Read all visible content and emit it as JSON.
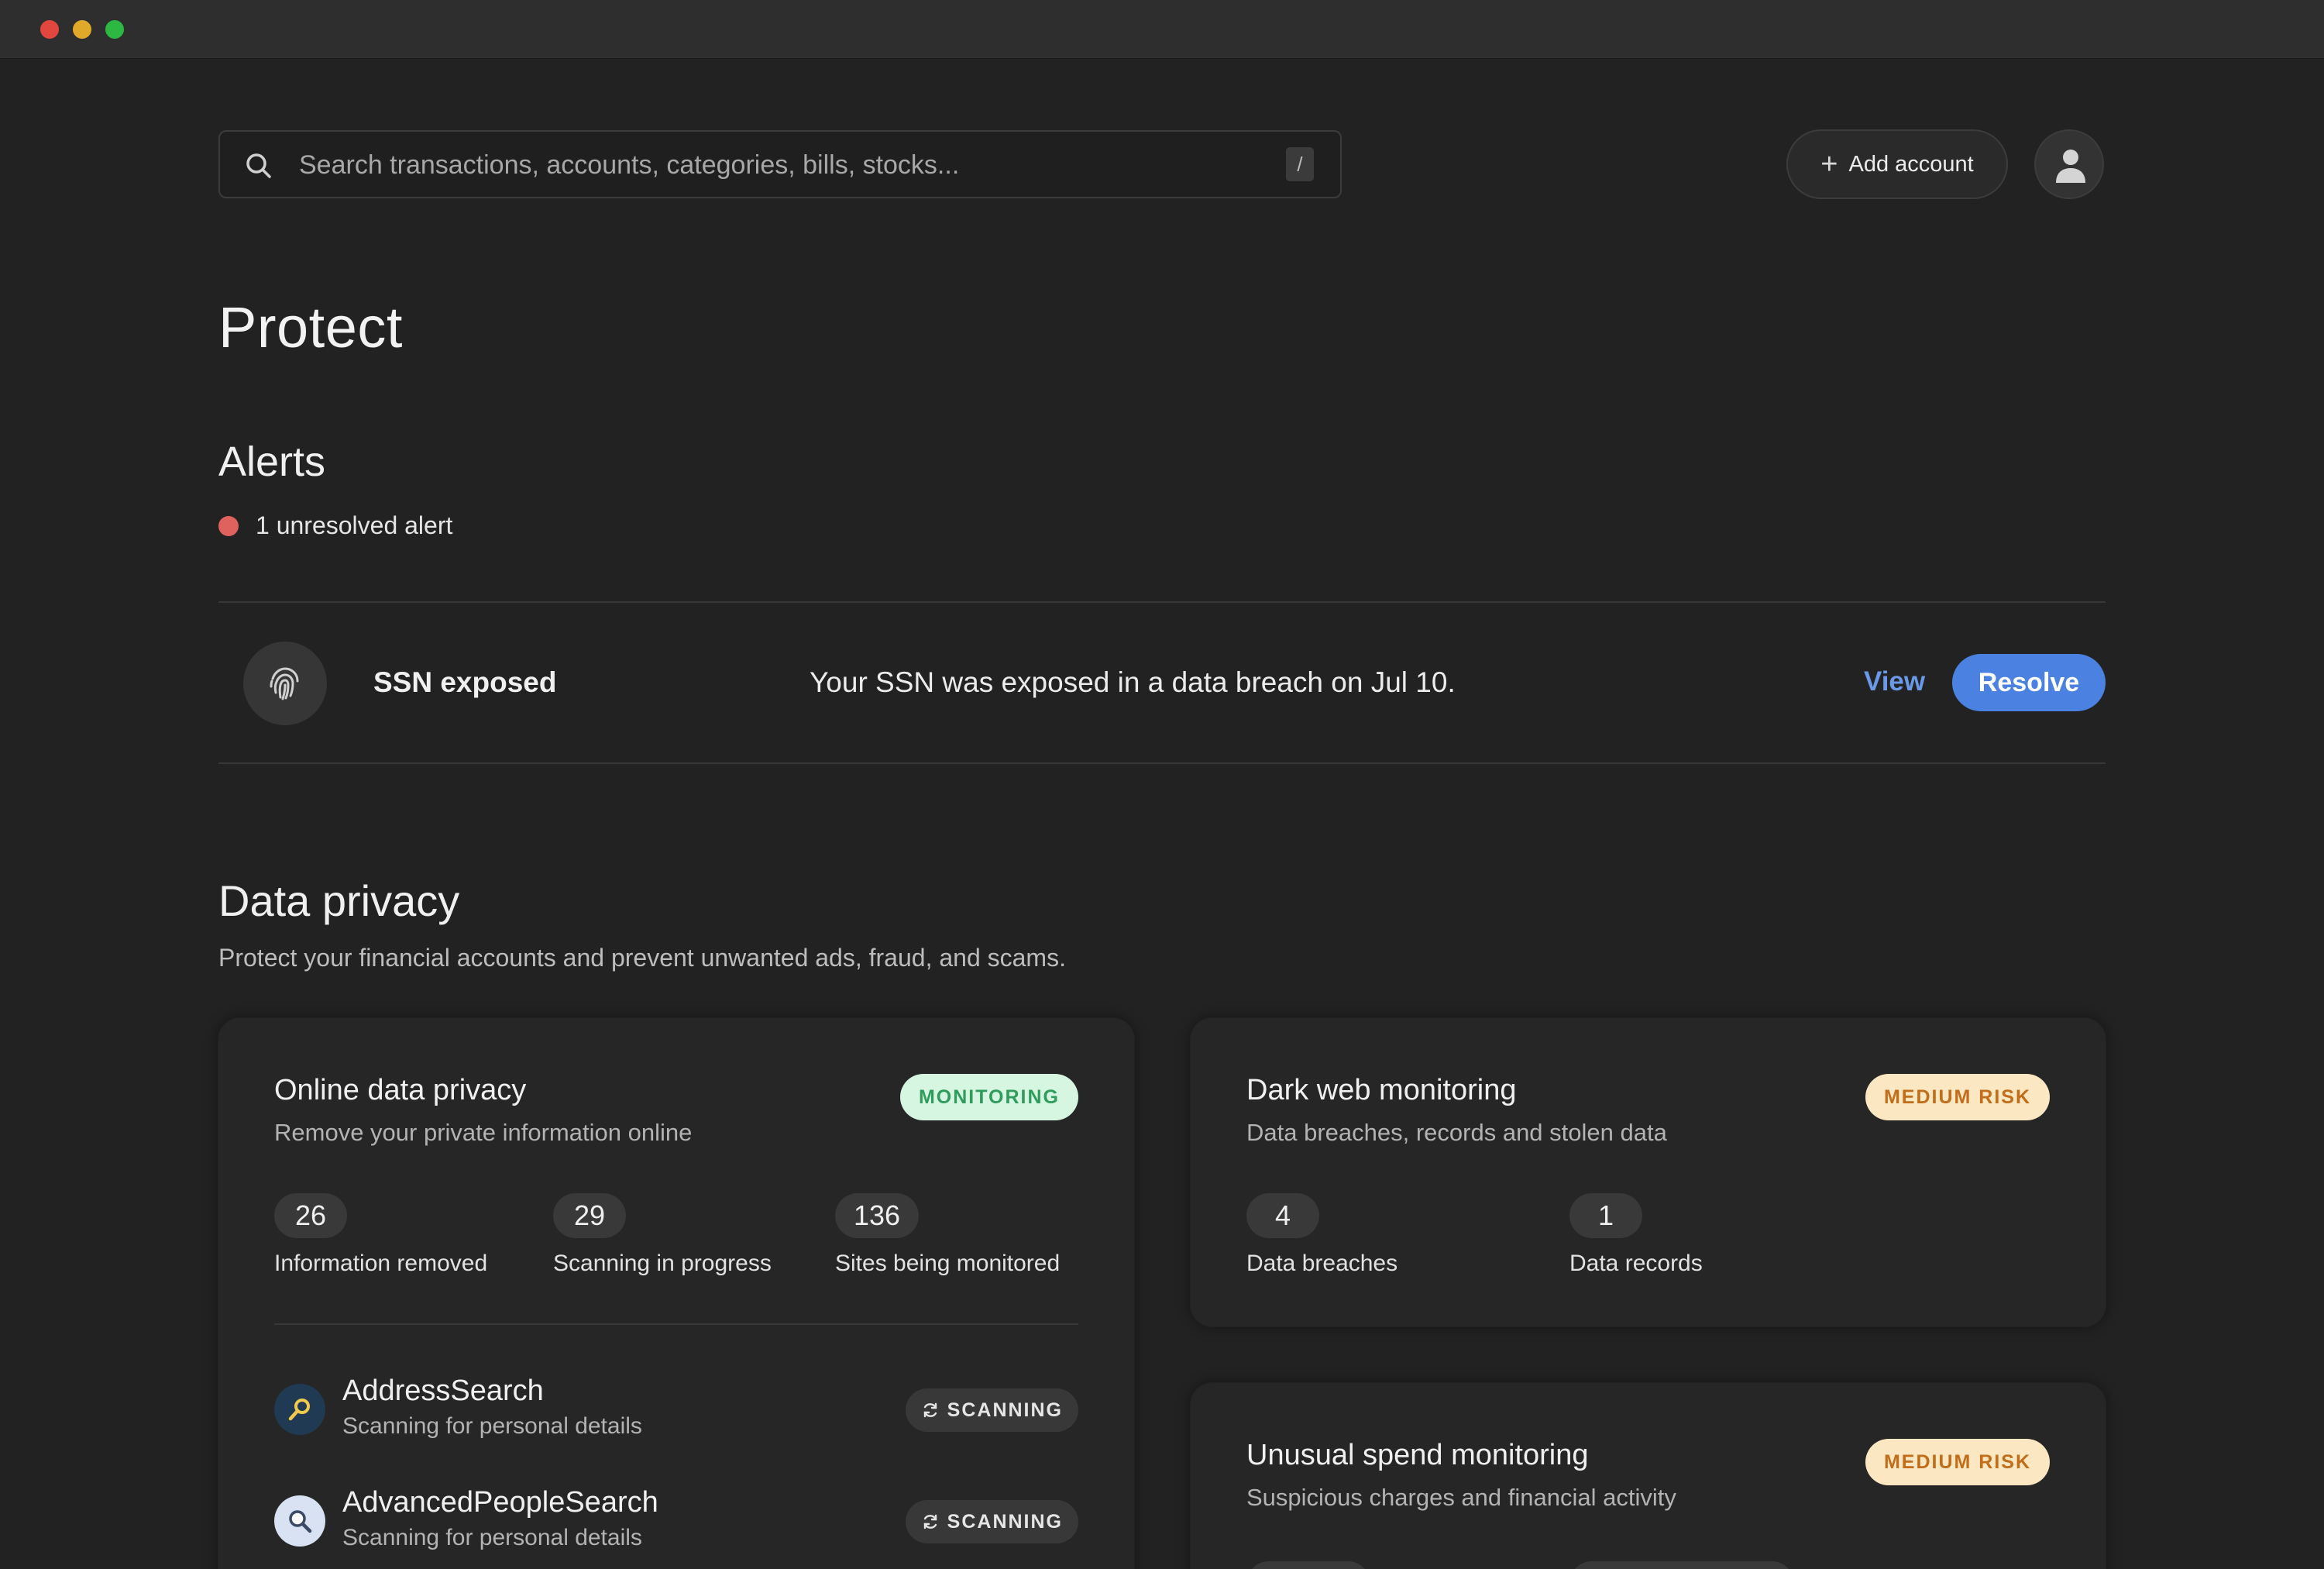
{
  "search": {
    "placeholder": "Search transactions, accounts, categories, bills, stocks...",
    "shortcut": "/"
  },
  "header": {
    "add_account_label": "Add account"
  },
  "page": {
    "title": "Protect"
  },
  "alerts": {
    "title": "Alerts",
    "count_text": "1 unresolved alert",
    "items": [
      {
        "name": "SSN exposed",
        "description": "Your SSN was exposed in a data breach on Jul 10.",
        "view_label": "View",
        "resolve_label": "Resolve",
        "icon": "fingerprint-icon"
      }
    ]
  },
  "data_privacy": {
    "title": "Data privacy",
    "subtitle": "Protect your financial accounts and prevent unwanted ads, fraud, and scams.",
    "cards": [
      {
        "title": "Online data privacy",
        "subtitle": "Remove your private information online",
        "badge": "MONITORING",
        "stats": [
          {
            "value": "26",
            "label": "Information removed"
          },
          {
            "value": "29",
            "label": "Scanning in progress"
          },
          {
            "value": "136",
            "label": "Sites being monitored"
          }
        ],
        "sites": [
          {
            "name": "AddressSearch",
            "subtitle": "Scanning for personal details",
            "status": "SCANNING"
          },
          {
            "name": "AdvancedPeopleSearch",
            "subtitle": "Scanning for personal details",
            "status": "SCANNING"
          }
        ]
      },
      {
        "title": "Dark web monitoring",
        "subtitle": "Data breaches, records and stolen data",
        "badge": "MEDIUM RISK",
        "stats": [
          {
            "value": "4",
            "label": "Data breaches"
          },
          {
            "value": "1",
            "label": "Data records"
          }
        ]
      },
      {
        "title": "Unusual spend monitoring",
        "subtitle": "Suspicious charges and financial activity",
        "badge": "MEDIUM RISK"
      }
    ]
  },
  "colors": {
    "background": "#222222",
    "accent_blue": "#4b82e2",
    "alert_red": "#e0625e",
    "badge_green_bg": "#d6f6e1",
    "badge_orange_bg": "#fbe7c2"
  }
}
